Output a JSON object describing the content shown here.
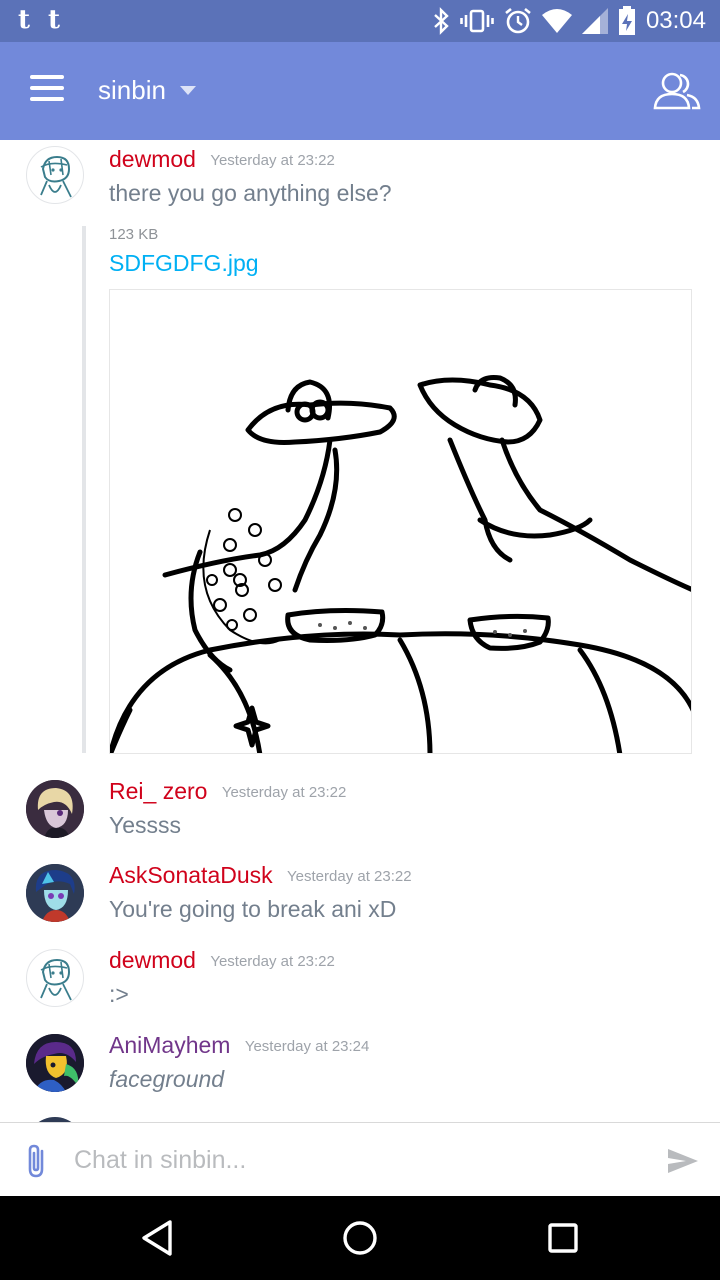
{
  "status_bar": {
    "left_icons": [
      "tumblr-plus-icon",
      "tumblr-icon"
    ],
    "left_glyphs": [
      "t",
      "t"
    ],
    "right_icons": [
      "bluetooth-icon",
      "vibrate-icon",
      "alarm-icon",
      "wifi-icon",
      "signal-icon",
      "battery-icon"
    ],
    "time": "03:04"
  },
  "app_bar": {
    "channel": "sinbin",
    "menu_icon": "hamburger-menu-icon",
    "dropdown_icon": "chevron-down-icon",
    "members_icon": "members-icon",
    "color": "#7289da"
  },
  "messages": [
    {
      "author": "dewmod",
      "author_color": "#d0021b",
      "timestamp": "Yesterday at 23:22",
      "text": "there you go anything else?",
      "attachment": {
        "size": "123 KB",
        "filename": "SDFGDFG.jpg"
      }
    },
    {
      "author": "Rei_ zero",
      "author_color": "#d0021b",
      "timestamp": "Yesterday at 23:22",
      "text": "Yessss"
    },
    {
      "author": "AskSonataDusk",
      "author_color": "#d0021b",
      "timestamp": "Yesterday at 23:22",
      "text": "You're going to break ani xD"
    },
    {
      "author": "dewmod",
      "author_color": "#d0021b",
      "timestamp": "Yesterday at 23:22",
      "text": ":>"
    },
    {
      "author": "AniMayhem",
      "author_color": "#71368a",
      "timestamp": "Yesterday at 23:24",
      "text": "faceground"
    }
  ],
  "composer": {
    "placeholder": "Chat in sinbin...",
    "attach_icon": "paperclip-icon",
    "send_icon": "send-icon"
  },
  "nav_bar": {
    "icons": [
      "back-icon",
      "home-icon",
      "recents-icon"
    ]
  }
}
